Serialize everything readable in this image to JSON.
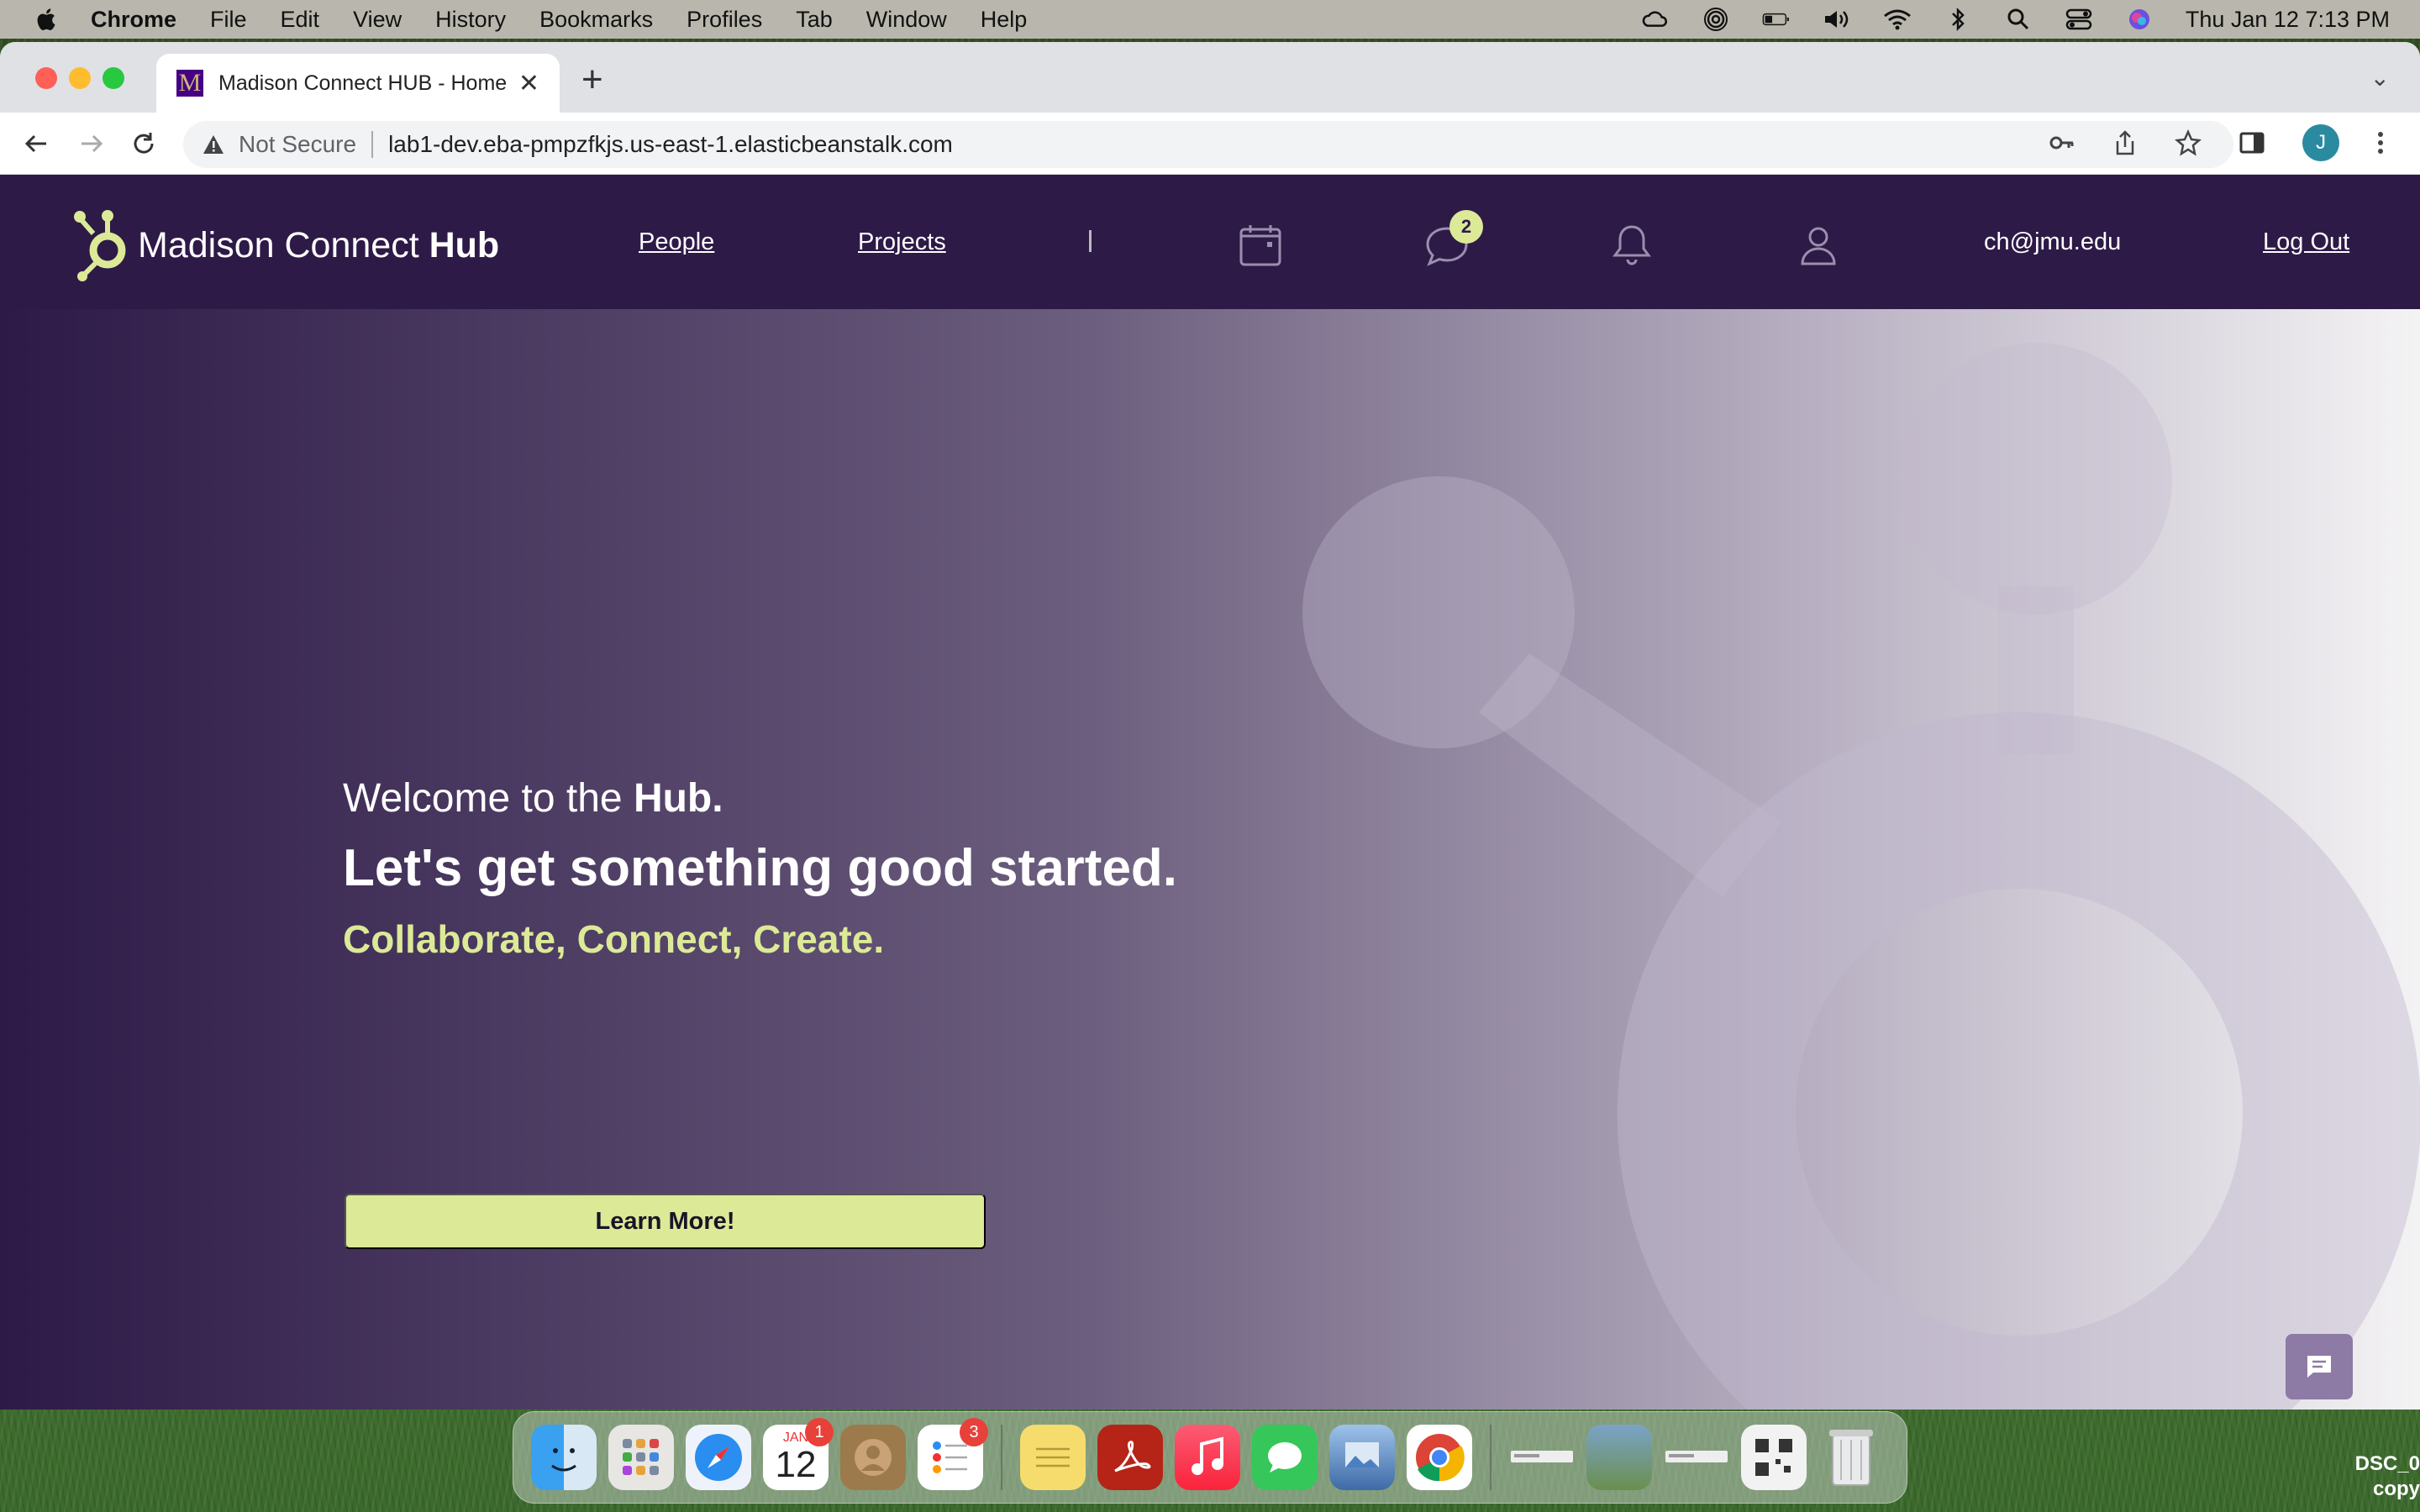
{
  "menubar": {
    "app_name": "Chrome",
    "items": [
      "File",
      "Edit",
      "View",
      "History",
      "Bookmarks",
      "Profiles",
      "Tab",
      "Window",
      "Help"
    ],
    "clock": "Thu Jan 12  7:13 PM"
  },
  "browser": {
    "tab_title": "Madison Connect HUB - Home",
    "favicon_letter": "M",
    "security_label": "Not Secure",
    "url": "lab1-dev.eba-pmpzfkjs.us-east-1.elasticbeanstalk.com",
    "profile_initial": "J"
  },
  "site": {
    "brand_light": "Madison Connect ",
    "brand_bold": "Hub",
    "nav": {
      "people": "People",
      "projects": "Projects",
      "user_email": "ch@jmu.edu",
      "logout": "Log Out"
    },
    "messages_badge": "2",
    "hero": {
      "welcome_prefix": "Welcome to the ",
      "welcome_bold": "Hub.",
      "headline": "Let's get something good started.",
      "tagline": "Collaborate, Connect, Create.",
      "cta": "Learn More!"
    },
    "colors": {
      "header_bg": "#2d1a47",
      "accent": "#dce997",
      "chat_button": "#8d7ba6"
    }
  },
  "dock": {
    "calendar_month": "JAN",
    "calendar_day": "12",
    "calendar_badge": "1",
    "reminders_badge": "3"
  },
  "desktop": {
    "file_label_1": "DSC_0",
    "file_label_2": "copy"
  }
}
